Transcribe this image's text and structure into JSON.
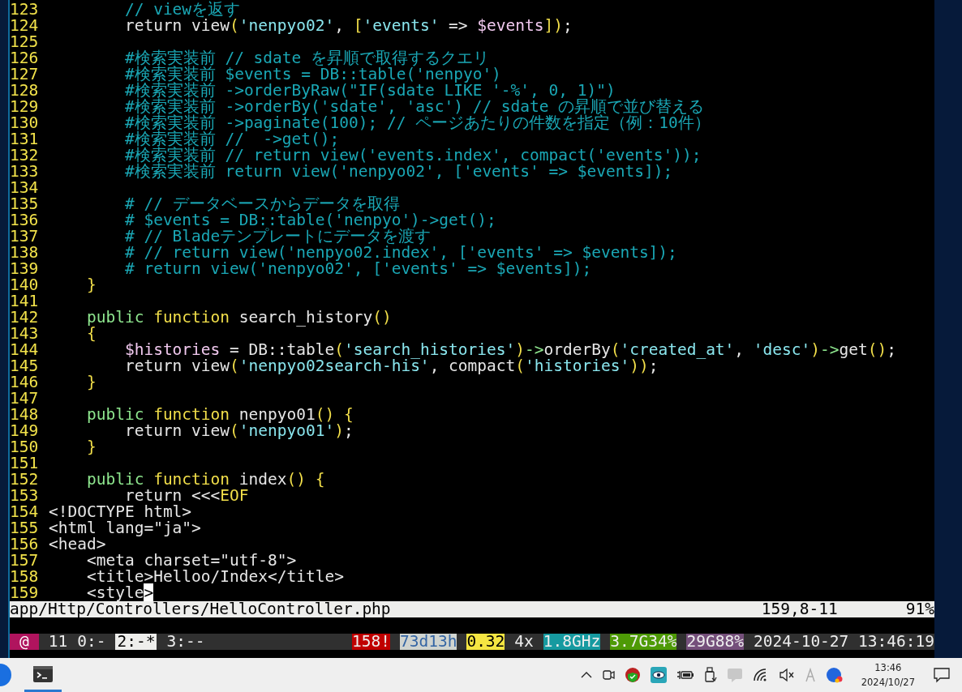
{
  "editor": {
    "lines": [
      {
        "number": "123",
        "segments": [
          {
            "text": "        // viewを返す",
            "kind": "comment"
          }
        ]
      },
      {
        "number": "124",
        "segments": [
          {
            "text": "        return view",
            "kind": "plain"
          },
          {
            "text": "(",
            "kind": "punct"
          },
          {
            "text": "'nenpyo02'",
            "kind": "string"
          },
          {
            "text": ", ",
            "kind": "plain"
          },
          {
            "text": "[",
            "kind": "punct"
          },
          {
            "text": "'events'",
            "kind": "string"
          },
          {
            "text": " => ",
            "kind": "plain"
          },
          {
            "text": "$events",
            "kind": "variable"
          },
          {
            "text": "])",
            "kind": "punct"
          },
          {
            "text": ";",
            "kind": "plain"
          }
        ]
      },
      {
        "number": "125"
      },
      {
        "number": "126",
        "segments": [
          {
            "text": "        #検索実装前 // sdate を昇順で取得するクエリ",
            "kind": "comment"
          }
        ]
      },
      {
        "number": "127",
        "segments": [
          {
            "text": "        #検索実装前 $events = DB::table('nenpyo')",
            "kind": "comment"
          }
        ]
      },
      {
        "number": "128",
        "segments": [
          {
            "text": "        #検索実装前 ->orderByRaw(\"IF(sdate LIKE '-%', 0, 1)\")",
            "kind": "comment"
          }
        ]
      },
      {
        "number": "129",
        "segments": [
          {
            "text": "        #検索実装前 ->orderBy('sdate', 'asc') // sdate の昇順で並び替える",
            "kind": "comment"
          }
        ]
      },
      {
        "number": "130",
        "segments": [
          {
            "text": "        #検索実装前 ->paginate(100); // ページあたりの件数を指定（例：10件）",
            "kind": "comment"
          }
        ]
      },
      {
        "number": "131",
        "segments": [
          {
            "text": "        #検索実装前 //  ->get();",
            "kind": "comment"
          }
        ]
      },
      {
        "number": "132",
        "segments": [
          {
            "text": "        #検索実装前 // return view('events.index', compact('events'));",
            "kind": "comment"
          }
        ]
      },
      {
        "number": "133",
        "segments": [
          {
            "text": "        #検索実装前 return view('nenpyo02', ['events' => $events]);",
            "kind": "comment"
          }
        ]
      },
      {
        "number": "134"
      },
      {
        "number": "135",
        "segments": [
          {
            "text": "        # // データベースからデータを取得",
            "kind": "comment"
          }
        ]
      },
      {
        "number": "136",
        "segments": [
          {
            "text": "        # $events = DB::table('nenpyo')->get();",
            "kind": "comment"
          }
        ]
      },
      {
        "number": "137",
        "segments": [
          {
            "text": "        # // Bladeテンプレートにデータを渡す",
            "kind": "comment"
          }
        ]
      },
      {
        "number": "138",
        "segments": [
          {
            "text": "        # // return view('nenpyo02.index', ['events' => $events]);",
            "kind": "comment"
          }
        ]
      },
      {
        "number": "139",
        "segments": [
          {
            "text": "        # return view('nenpyo02', ['events' => $events]);",
            "kind": "comment"
          }
        ]
      },
      {
        "number": "140",
        "segments": [
          {
            "text": "    }",
            "kind": "punct"
          }
        ]
      },
      {
        "number": "141"
      },
      {
        "number": "142",
        "segments": [
          {
            "text": "    public ",
            "kind": "keyword"
          },
          {
            "text": "function ",
            "kind": "function"
          },
          {
            "text": "search_history",
            "kind": "plain"
          },
          {
            "text": "()",
            "kind": "punct"
          }
        ]
      },
      {
        "number": "143",
        "segments": [
          {
            "text": "    {",
            "kind": "punct"
          }
        ]
      },
      {
        "number": "144",
        "segments": [
          {
            "text": "        $histories",
            "kind": "variable"
          },
          {
            "text": " = DB::table",
            "kind": "plain"
          },
          {
            "text": "(",
            "kind": "punct"
          },
          {
            "text": "'search_histories'",
            "kind": "string"
          },
          {
            "text": ")",
            "kind": "punct"
          },
          {
            "text": "->",
            "kind": "arrow"
          },
          {
            "text": "orderBy",
            "kind": "plain"
          },
          {
            "text": "(",
            "kind": "punct"
          },
          {
            "text": "'created_at'",
            "kind": "string"
          },
          {
            "text": ", ",
            "kind": "plain"
          },
          {
            "text": "'desc'",
            "kind": "string"
          },
          {
            "text": ")",
            "kind": "punct"
          },
          {
            "text": "->",
            "kind": "arrow"
          },
          {
            "text": "get",
            "kind": "plain"
          },
          {
            "text": "()",
            "kind": "punct"
          },
          {
            "text": ";",
            "kind": "plain"
          }
        ]
      },
      {
        "number": "145",
        "segments": [
          {
            "text": "        return view",
            "kind": "plain"
          },
          {
            "text": "(",
            "kind": "punct"
          },
          {
            "text": "'nenpyo02search-his'",
            "kind": "string"
          },
          {
            "text": ", compact",
            "kind": "plain"
          },
          {
            "text": "(",
            "kind": "punct"
          },
          {
            "text": "'histories'",
            "kind": "string"
          },
          {
            "text": "))",
            "kind": "punct"
          },
          {
            "text": ";",
            "kind": "plain"
          }
        ]
      },
      {
        "number": "146",
        "segments": [
          {
            "text": "    }",
            "kind": "punct"
          }
        ]
      },
      {
        "number": "147"
      },
      {
        "number": "148",
        "segments": [
          {
            "text": "    public ",
            "kind": "keyword"
          },
          {
            "text": "function ",
            "kind": "function"
          },
          {
            "text": "nenpyo01",
            "kind": "plain"
          },
          {
            "text": "() {",
            "kind": "punct"
          }
        ]
      },
      {
        "number": "149",
        "segments": [
          {
            "text": "        return view",
            "kind": "plain"
          },
          {
            "text": "(",
            "kind": "punct"
          },
          {
            "text": "'nenpyo01'",
            "kind": "string"
          },
          {
            "text": ")",
            "kind": "punct"
          },
          {
            "text": ";",
            "kind": "plain"
          }
        ]
      },
      {
        "number": "150",
        "segments": [
          {
            "text": "    }",
            "kind": "punct"
          }
        ]
      },
      {
        "number": "151"
      },
      {
        "number": "152",
        "segments": [
          {
            "text": "    public ",
            "kind": "keyword"
          },
          {
            "text": "function ",
            "kind": "function"
          },
          {
            "text": "index",
            "kind": "plain"
          },
          {
            "text": "() {",
            "kind": "punct"
          }
        ]
      },
      {
        "number": "153",
        "segments": [
          {
            "text": "        return <<<",
            "kind": "plain"
          },
          {
            "text": "EOF",
            "kind": "punct"
          }
        ]
      },
      {
        "number": "154",
        "segments": [
          {
            "text": "<!DOCTYPE html>",
            "kind": "plain"
          }
        ]
      },
      {
        "number": "155",
        "segments": [
          {
            "text": "<html lang=\"ja\">",
            "kind": "plain"
          }
        ]
      },
      {
        "number": "156",
        "segments": [
          {
            "text": "<head>",
            "kind": "plain"
          }
        ]
      },
      {
        "number": "157",
        "segments": [
          {
            "text": "    <meta charset=\"utf-8\">",
            "kind": "plain"
          }
        ]
      },
      {
        "number": "158",
        "segments": [
          {
            "text": "    <title>Helloo/Index</title>",
            "kind": "plain"
          }
        ]
      },
      {
        "number": "159",
        "segments": [
          {
            "text": "    <style",
            "kind": "plain"
          },
          {
            "text": ">",
            "kind": "cursor"
          }
        ]
      }
    ],
    "status_line": {
      "file": "app/Http/Controllers/HelloController.php",
      "position": "159,8-11",
      "percent": "91%"
    }
  },
  "tmux_bar": {
    "prefix": "@",
    "session": "11",
    "windows": [
      {
        "label": "0:-",
        "selected": false
      },
      {
        "label": "2:-*",
        "selected": true
      },
      {
        "label": "3:--",
        "selected": false
      }
    ],
    "stats": [
      {
        "text": "158!",
        "color": "#c00000"
      },
      {
        "text": "73d13h",
        "color": "#d0d4d0"
      },
      {
        "text": "0.32",
        "color": "#f5e642"
      },
      {
        "text": "4x",
        "color": "#303030"
      },
      {
        "text": "1.8GHz",
        "color": "#169aa0"
      },
      {
        "text": "3.7G34%",
        "color": "#4e9a06"
      },
      {
        "text": "29G88%",
        "color": "#75507b"
      },
      {
        "text": "2024-10-27 13:46:19",
        "color": "#303030"
      }
    ]
  },
  "taskbar": {
    "clock_time": "13:46",
    "clock_date": "2024/10/27"
  }
}
